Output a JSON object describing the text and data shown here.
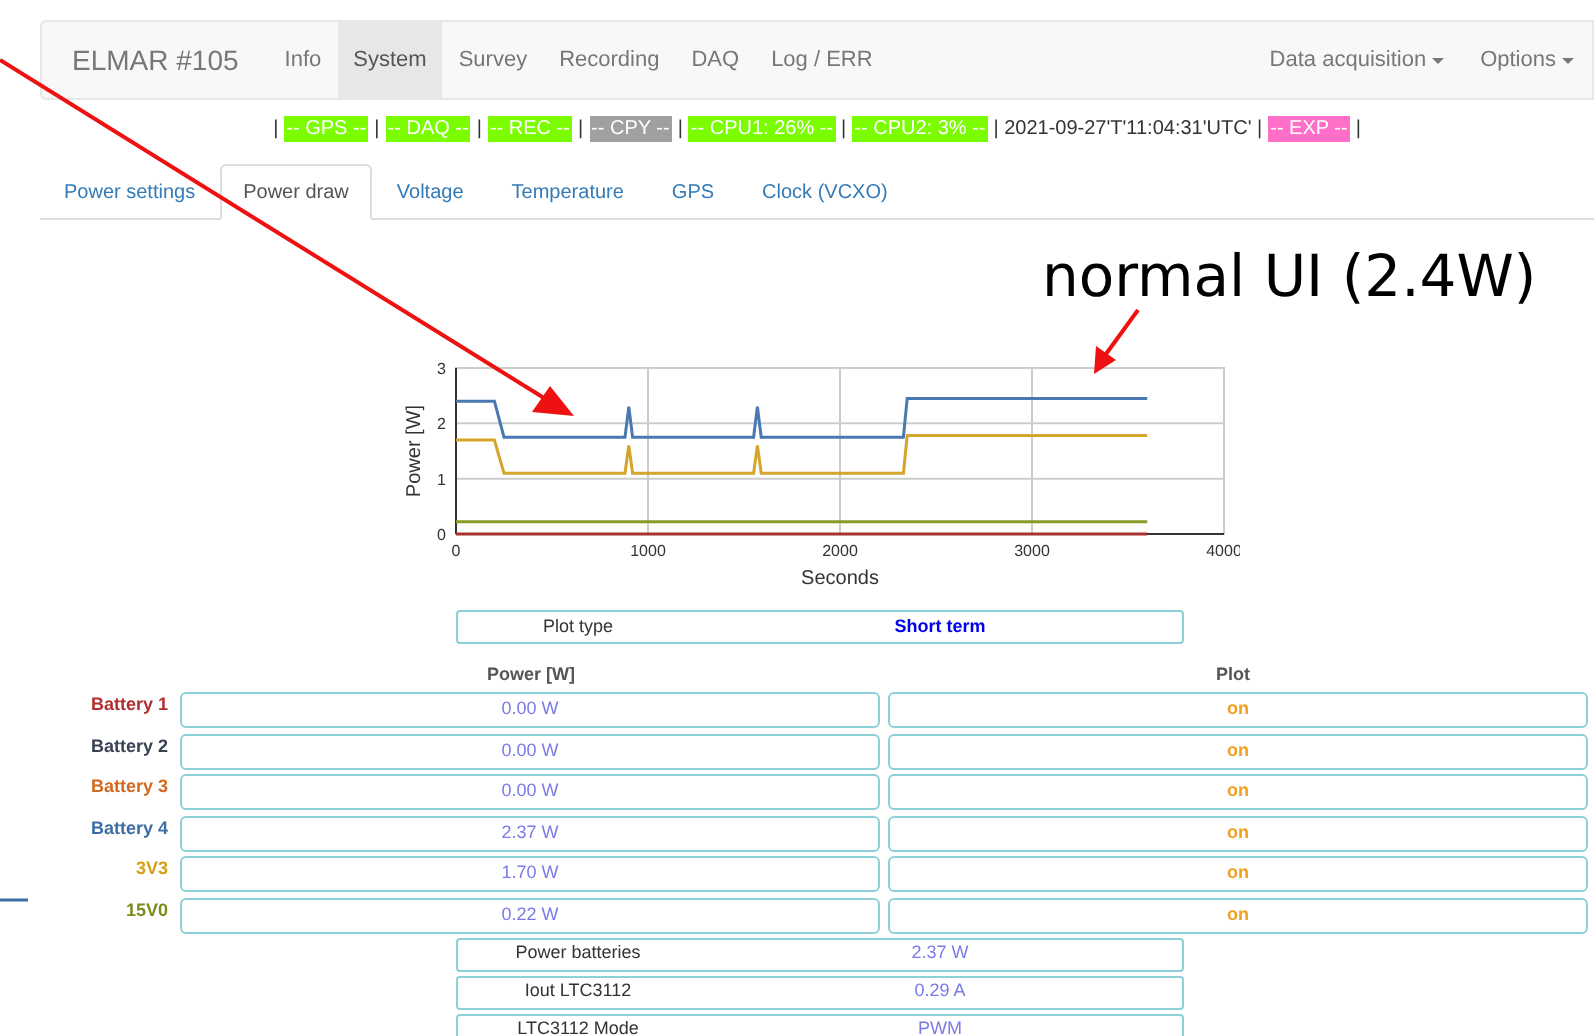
{
  "navbar": {
    "brand": "ELMAR #105",
    "items": [
      {
        "label": "Info",
        "selected": false
      },
      {
        "label": "System",
        "selected": true
      },
      {
        "label": "Survey",
        "selected": false
      },
      {
        "label": "Recording",
        "selected": false
      },
      {
        "label": "DAQ",
        "selected": false
      },
      {
        "label": "Log / ERR",
        "selected": false
      }
    ],
    "menus": [
      "Data acquisition",
      "Options"
    ]
  },
  "status_bar": [
    {
      "kind": "text",
      "text": "|"
    },
    {
      "kind": "badge",
      "text": "-- GPS --",
      "color": "#7cfc00"
    },
    {
      "kind": "text",
      "text": "|"
    },
    {
      "kind": "badge",
      "text": "-- DAQ --",
      "color": "#7cfc00"
    },
    {
      "kind": "text",
      "text": "|"
    },
    {
      "kind": "badge",
      "text": "-- REC --",
      "color": "#7cfc00"
    },
    {
      "kind": "text",
      "text": "|"
    },
    {
      "kind": "badge",
      "text": "-- CPY --",
      "color": "#a0a0a0"
    },
    {
      "kind": "text",
      "text": "|"
    },
    {
      "kind": "badge",
      "text": "-- CPU1: 26% --",
      "color": "#7cfc00"
    },
    {
      "kind": "text",
      "text": "|"
    },
    {
      "kind": "badge",
      "text": "-- CPU2: 3% --",
      "color": "#7cfc00"
    },
    {
      "kind": "text",
      "text": "| 2021-09-27'T'11:04:31'UTC' |"
    },
    {
      "kind": "badge",
      "text": "-- EXP --",
      "color": "#ff6ec7"
    },
    {
      "kind": "text",
      "text": "|"
    }
  ],
  "tabs": [
    {
      "label": "Power settings",
      "selected": false
    },
    {
      "label": "Power draw",
      "selected": true
    },
    {
      "label": "Voltage",
      "selected": false
    },
    {
      "label": "Temperature",
      "selected": false
    },
    {
      "label": "GPS",
      "selected": false
    },
    {
      "label": "Clock (VCXO)",
      "selected": false
    }
  ],
  "annotation": {
    "text": "normal UI (2.4W)"
  },
  "chart_data": {
    "type": "line",
    "xlabel": "Seconds",
    "ylabel": "Power [W]",
    "x": [
      0,
      200,
      250,
      880,
      900,
      920,
      1550,
      1570,
      1590,
      2330,
      2350,
      3600
    ],
    "series": [
      {
        "color": "#4a78b0",
        "values": [
          2.4,
          2.4,
          1.75,
          1.75,
          2.3,
          1.75,
          1.75,
          2.3,
          1.75,
          1.75,
          2.45,
          2.45
        ]
      },
      {
        "color": "#d4a52a",
        "values": [
          1.7,
          1.7,
          1.1,
          1.1,
          1.6,
          1.1,
          1.1,
          1.6,
          1.1,
          1.1,
          1.78,
          1.78
        ]
      },
      {
        "color": "#8c9a2a",
        "values": [
          0.22,
          0.22,
          0.22,
          0.22,
          0.22,
          0.22,
          0.22,
          0.22,
          0.22,
          0.22,
          0.22,
          0.22
        ]
      },
      {
        "color": "#a83232",
        "values": [
          0,
          0,
          0,
          0,
          0,
          0,
          0,
          0,
          0,
          0,
          0,
          0
        ]
      }
    ],
    "grid": true,
    "xlim": [
      0,
      4000
    ],
    "ylim": [
      0,
      3
    ],
    "xticks": [
      0,
      1000,
      2000,
      3000,
      4000
    ],
    "yticks": [
      0,
      1,
      2,
      3
    ]
  },
  "plot_type": {
    "label": "Plot type",
    "value": "Short term"
  },
  "power_table": {
    "columns": [
      "Power [W]",
      "Plot"
    ],
    "rows": [
      {
        "label": "Battery 1",
        "color": "#b03030",
        "power": "0.00 W",
        "plot": "on"
      },
      {
        "label": "Battery 2",
        "color": "#3a4256",
        "power": "0.00 W",
        "plot": "on"
      },
      {
        "label": "Battery 3",
        "color": "#d2691e",
        "power": "0.00 W",
        "plot": "on"
      },
      {
        "label": "Battery 4",
        "color": "#3c6ea5",
        "power": "2.37 W",
        "plot": "on"
      },
      {
        "label": "3V3",
        "color": "#d4a017",
        "power": "1.70 W",
        "plot": "on"
      },
      {
        "label": "15V0",
        "color": "#7a8c1a",
        "power": "0.22 W",
        "plot": "on"
      }
    ]
  },
  "summary": [
    {
      "label": "Power batteries",
      "value": "2.37 W"
    },
    {
      "label": "Iout LTC3112",
      "value": "0.29 A"
    },
    {
      "label": "LTC3112 Mode",
      "value": "PWM"
    }
  ]
}
